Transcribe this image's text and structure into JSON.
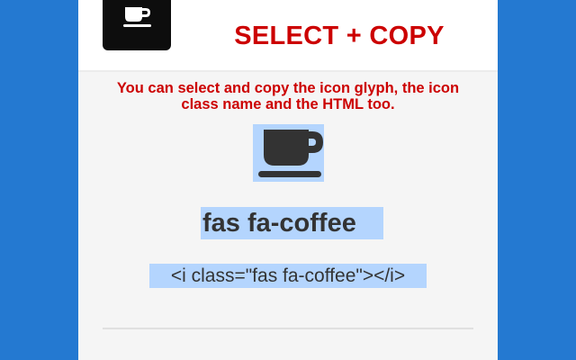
{
  "header": {
    "logo_icon": "coffee-cup-icon",
    "title": "SELECT + COPY"
  },
  "main": {
    "description": "You can select and copy the icon glyph, the icon class name and the HTML too.",
    "icon_glyph": "coffee-cup-icon",
    "icon_class_name": "fas fa-coffee",
    "icon_html": "<i class=\"fas fa-coffee\"></i>"
  },
  "colors": {
    "background": "#2479d1",
    "accent_red": "#cc0000",
    "selection": "#b4d5fe",
    "text_dark": "#333333",
    "logo_bg": "#0d0d0d"
  }
}
